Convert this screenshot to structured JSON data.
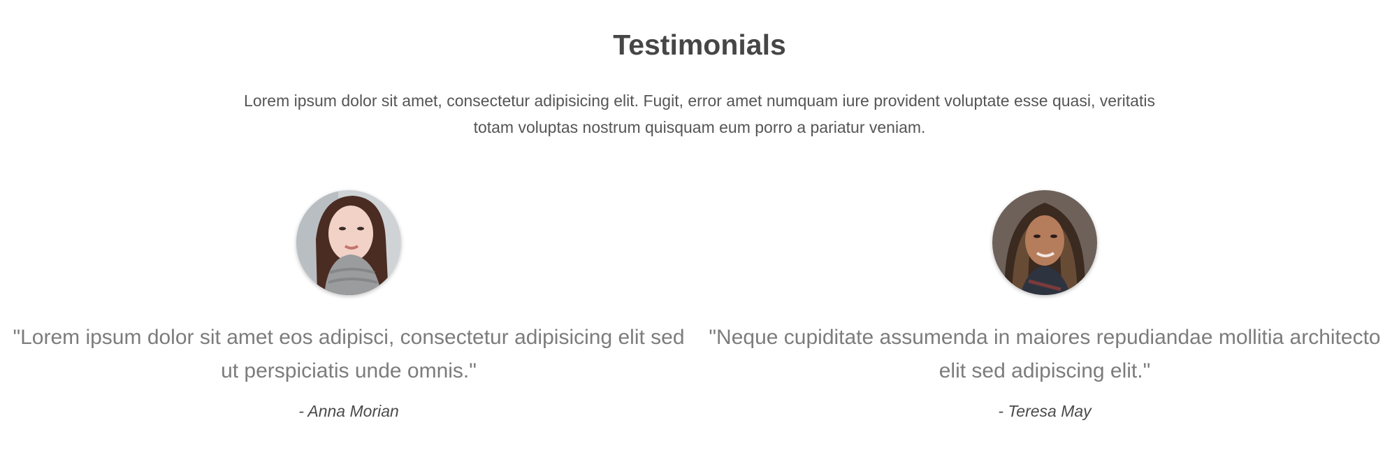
{
  "header": {
    "title": "Testimonials",
    "intro": "Lorem ipsum dolor sit amet, consectetur adipisicing elit. Fugit, error amet numquam iure provident voluptate esse quasi, veritatis totam voluptas nostrum quisquam eum porro a pariatur veniam."
  },
  "testimonials": [
    {
      "quote": "\"Lorem ipsum dolor sit amet eos adipisci, consectetur adipisicing elit sed ut perspiciatis unde omnis.\"",
      "author": "- Anna Morian",
      "avatar_icon": "avatar-photo"
    },
    {
      "quote": "\"Neque cupiditate assumenda in maiores repudiandae mollitia architecto elit sed adipiscing elit.\"",
      "author": "- Teresa May",
      "avatar_icon": "avatar-photo"
    }
  ]
}
